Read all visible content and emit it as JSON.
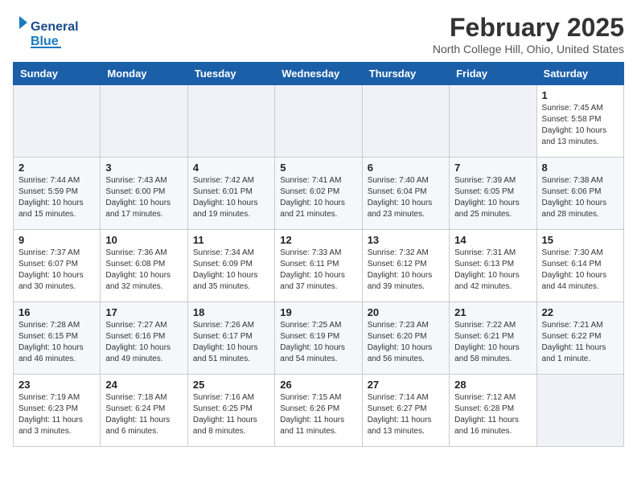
{
  "header": {
    "logo_line1": "General",
    "logo_line2": "Blue",
    "month": "February 2025",
    "location": "North College Hill, Ohio, United States"
  },
  "weekdays": [
    "Sunday",
    "Monday",
    "Tuesday",
    "Wednesday",
    "Thursday",
    "Friday",
    "Saturday"
  ],
  "weeks": [
    [
      {
        "day": "",
        "info": ""
      },
      {
        "day": "",
        "info": ""
      },
      {
        "day": "",
        "info": ""
      },
      {
        "day": "",
        "info": ""
      },
      {
        "day": "",
        "info": ""
      },
      {
        "day": "",
        "info": ""
      },
      {
        "day": "1",
        "info": "Sunrise: 7:45 AM\nSunset: 5:58 PM\nDaylight: 10 hours\nand 13 minutes."
      }
    ],
    [
      {
        "day": "2",
        "info": "Sunrise: 7:44 AM\nSunset: 5:59 PM\nDaylight: 10 hours\nand 15 minutes."
      },
      {
        "day": "3",
        "info": "Sunrise: 7:43 AM\nSunset: 6:00 PM\nDaylight: 10 hours\nand 17 minutes."
      },
      {
        "day": "4",
        "info": "Sunrise: 7:42 AM\nSunset: 6:01 PM\nDaylight: 10 hours\nand 19 minutes."
      },
      {
        "day": "5",
        "info": "Sunrise: 7:41 AM\nSunset: 6:02 PM\nDaylight: 10 hours\nand 21 minutes."
      },
      {
        "day": "6",
        "info": "Sunrise: 7:40 AM\nSunset: 6:04 PM\nDaylight: 10 hours\nand 23 minutes."
      },
      {
        "day": "7",
        "info": "Sunrise: 7:39 AM\nSunset: 6:05 PM\nDaylight: 10 hours\nand 25 minutes."
      },
      {
        "day": "8",
        "info": "Sunrise: 7:38 AM\nSunset: 6:06 PM\nDaylight: 10 hours\nand 28 minutes."
      }
    ],
    [
      {
        "day": "9",
        "info": "Sunrise: 7:37 AM\nSunset: 6:07 PM\nDaylight: 10 hours\nand 30 minutes."
      },
      {
        "day": "10",
        "info": "Sunrise: 7:36 AM\nSunset: 6:08 PM\nDaylight: 10 hours\nand 32 minutes."
      },
      {
        "day": "11",
        "info": "Sunrise: 7:34 AM\nSunset: 6:09 PM\nDaylight: 10 hours\nand 35 minutes."
      },
      {
        "day": "12",
        "info": "Sunrise: 7:33 AM\nSunset: 6:11 PM\nDaylight: 10 hours\nand 37 minutes."
      },
      {
        "day": "13",
        "info": "Sunrise: 7:32 AM\nSunset: 6:12 PM\nDaylight: 10 hours\nand 39 minutes."
      },
      {
        "day": "14",
        "info": "Sunrise: 7:31 AM\nSunset: 6:13 PM\nDaylight: 10 hours\nand 42 minutes."
      },
      {
        "day": "15",
        "info": "Sunrise: 7:30 AM\nSunset: 6:14 PM\nDaylight: 10 hours\nand 44 minutes."
      }
    ],
    [
      {
        "day": "16",
        "info": "Sunrise: 7:28 AM\nSunset: 6:15 PM\nDaylight: 10 hours\nand 46 minutes."
      },
      {
        "day": "17",
        "info": "Sunrise: 7:27 AM\nSunset: 6:16 PM\nDaylight: 10 hours\nand 49 minutes."
      },
      {
        "day": "18",
        "info": "Sunrise: 7:26 AM\nSunset: 6:17 PM\nDaylight: 10 hours\nand 51 minutes."
      },
      {
        "day": "19",
        "info": "Sunrise: 7:25 AM\nSunset: 6:19 PM\nDaylight: 10 hours\nand 54 minutes."
      },
      {
        "day": "20",
        "info": "Sunrise: 7:23 AM\nSunset: 6:20 PM\nDaylight: 10 hours\nand 56 minutes."
      },
      {
        "day": "21",
        "info": "Sunrise: 7:22 AM\nSunset: 6:21 PM\nDaylight: 10 hours\nand 58 minutes."
      },
      {
        "day": "22",
        "info": "Sunrise: 7:21 AM\nSunset: 6:22 PM\nDaylight: 11 hours\nand 1 minute."
      }
    ],
    [
      {
        "day": "23",
        "info": "Sunrise: 7:19 AM\nSunset: 6:23 PM\nDaylight: 11 hours\nand 3 minutes."
      },
      {
        "day": "24",
        "info": "Sunrise: 7:18 AM\nSunset: 6:24 PM\nDaylight: 11 hours\nand 6 minutes."
      },
      {
        "day": "25",
        "info": "Sunrise: 7:16 AM\nSunset: 6:25 PM\nDaylight: 11 hours\nand 8 minutes."
      },
      {
        "day": "26",
        "info": "Sunrise: 7:15 AM\nSunset: 6:26 PM\nDaylight: 11 hours\nand 11 minutes."
      },
      {
        "day": "27",
        "info": "Sunrise: 7:14 AM\nSunset: 6:27 PM\nDaylight: 11 hours\nand 13 minutes."
      },
      {
        "day": "28",
        "info": "Sunrise: 7:12 AM\nSunset: 6:28 PM\nDaylight: 11 hours\nand 16 minutes."
      },
      {
        "day": "",
        "info": ""
      }
    ]
  ]
}
